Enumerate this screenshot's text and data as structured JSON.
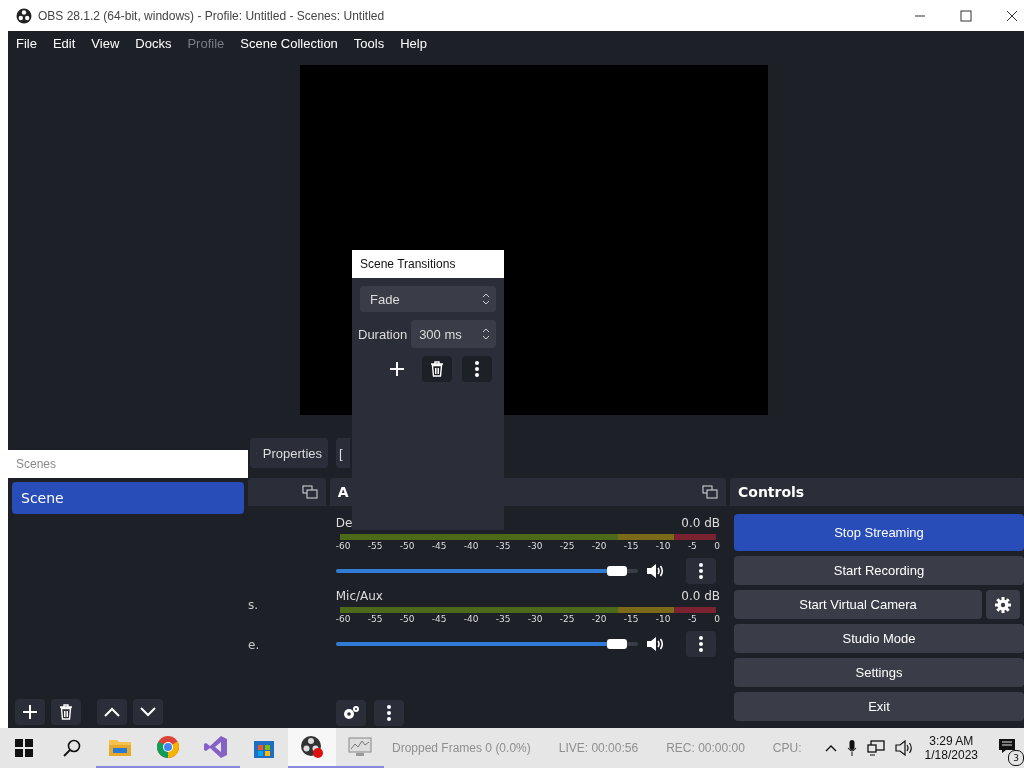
{
  "window": {
    "title": "OBS 28.1.2 (64-bit, windows) - Profile: Untitled - Scenes: Untitled"
  },
  "menu": [
    {
      "label": "File",
      "disabled": false
    },
    {
      "label": "Edit",
      "disabled": false
    },
    {
      "label": "View",
      "disabled": false
    },
    {
      "label": "Docks",
      "disabled": false
    },
    {
      "label": "Profile",
      "disabled": true
    },
    {
      "label": "Scene Collection",
      "disabled": false
    },
    {
      "label": "Tools",
      "disabled": false
    },
    {
      "label": "Help",
      "disabled": false
    }
  ],
  "preview_toolbar": {
    "properties_button": "Properties",
    "cut_button": "["
  },
  "scenes": {
    "title": "Scenes",
    "items": [
      {
        "label": "Scene",
        "selected": true
      }
    ]
  },
  "sources": {
    "cut_texts": [
      "s.",
      "e."
    ]
  },
  "audio_mixer": {
    "title_cut": "A",
    "channels": [
      {
        "name": "De",
        "reading": "0.0 dB",
        "ticks": [
          "-60",
          "-55",
          "-50",
          "-45",
          "-40",
          "-35",
          "-30",
          "-25",
          "-20",
          "-15",
          "-10",
          "-5",
          "0"
        ],
        "level": 0.93,
        "muted": false
      },
      {
        "name": "Mic/Aux",
        "reading": "0.0 dB",
        "ticks": [
          "-60",
          "-55",
          "-50",
          "-45",
          "-40",
          "-35",
          "-30",
          "-25",
          "-20",
          "-15",
          "-10",
          "-5",
          "0"
        ],
        "level": 0.93,
        "muted": false
      }
    ]
  },
  "transitions": {
    "title": "Scene Transitions",
    "transition": "Fade",
    "duration_label": "Duration",
    "duration": "300 ms"
  },
  "controls": {
    "title": "Controls",
    "buttons": [
      {
        "label": "Stop Streaming",
        "kind": "plain",
        "active": true
      },
      {
        "label": "Start Recording",
        "kind": "plain",
        "active": false
      },
      {
        "label": "Start Virtual Camera",
        "kind": "with-settings",
        "active": false
      },
      {
        "label": "Studio Mode",
        "kind": "plain",
        "active": false
      },
      {
        "label": "Settings",
        "kind": "plain",
        "active": false
      },
      {
        "label": "Exit",
        "kind": "plain",
        "active": false
      }
    ]
  },
  "taskbar": {
    "status": [
      "Dropped Frames 0 (0.0%)",
      "LIVE: 00:00:56",
      "REC: 00:00:00",
      "CPU:"
    ],
    "time": "3:29 AM",
    "date": "1/18/2023",
    "notifications": "3"
  }
}
